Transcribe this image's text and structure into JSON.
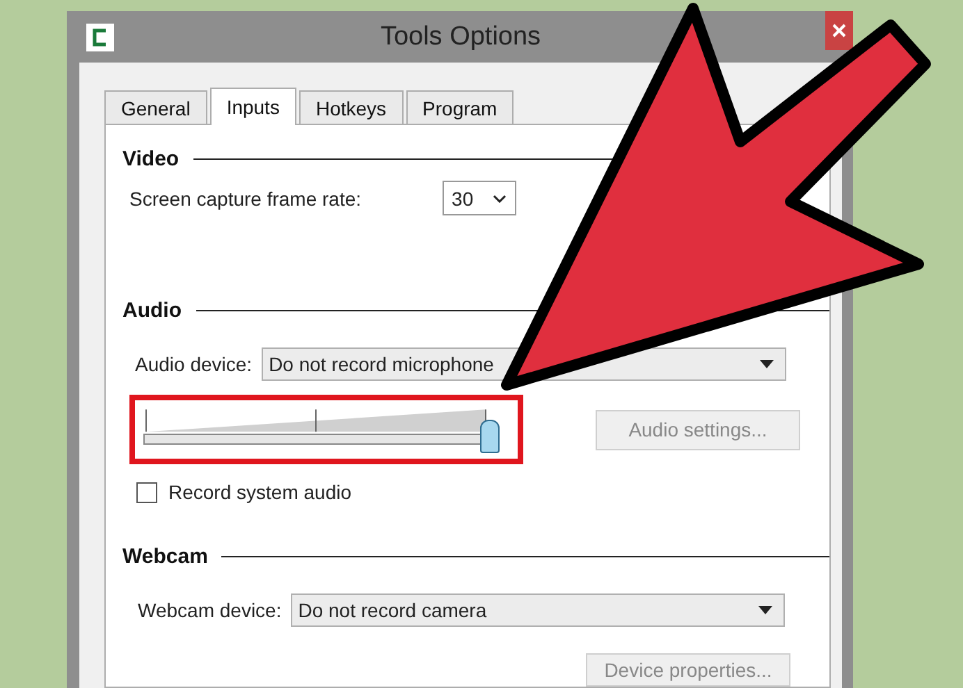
{
  "window": {
    "title": "Tools Options"
  },
  "tabs": [
    {
      "label": "General",
      "selected": false
    },
    {
      "label": "Inputs",
      "selected": true
    },
    {
      "label": "Hotkeys",
      "selected": false
    },
    {
      "label": "Program",
      "selected": false
    }
  ],
  "video": {
    "heading": "Video",
    "frame_rate_label": "Screen capture frame rate:",
    "frame_rate": "30"
  },
  "audio": {
    "heading": "Audio",
    "device_label": "Audio device:",
    "device": "Do not record microphone",
    "volume": {
      "level": 1
    },
    "settings_button": "Audio settings...",
    "record_system_audio": {
      "label": "Record system audio",
      "checked": false
    }
  },
  "webcam": {
    "heading": "Webcam",
    "device_label": "Webcam device:",
    "device": "Do not record camera",
    "properties_button": "Device properties..."
  }
}
